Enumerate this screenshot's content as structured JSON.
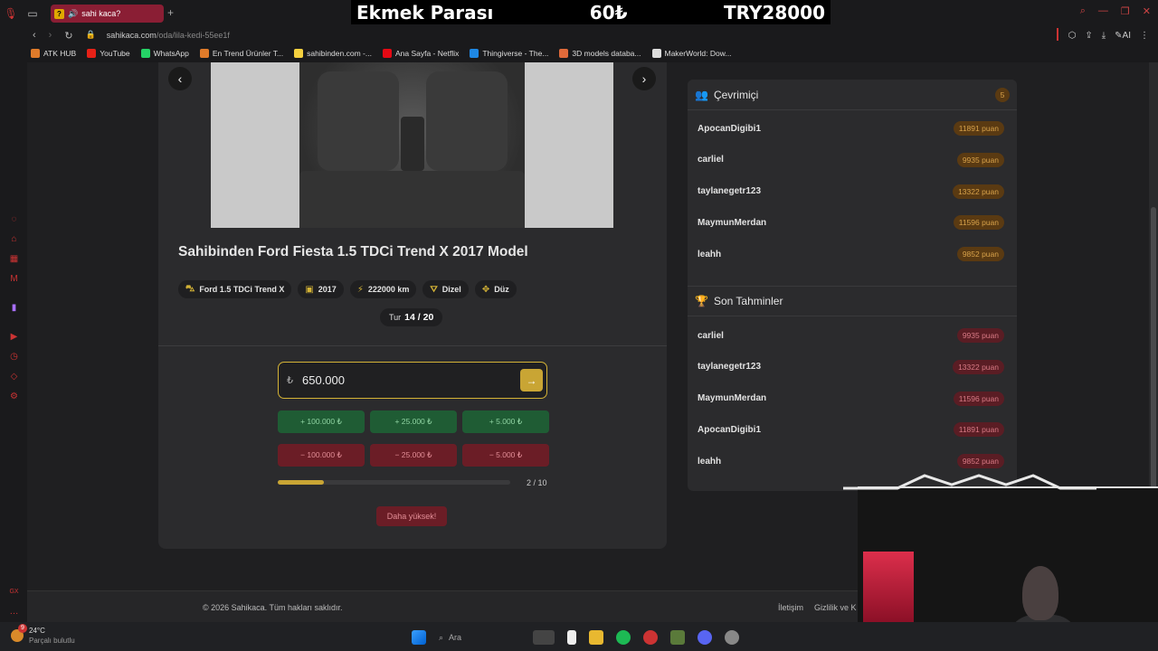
{
  "browser": {
    "tab_title": "sahi kaca?",
    "url_domain": "sahikaca.com",
    "url_path": "/oda/lila-kedi-55ee1f",
    "bookmarks": [
      "ATK HUB",
      "YouTube",
      "WhatsApp",
      "En Trend Ürünler T...",
      "sahibinden.com -...",
      "Ana Sayfa - Netflix",
      "Thingiverse - The...",
      "3D models databa...",
      "MakerWorld: Dow..."
    ],
    "bookmark_colors": [
      "#e07b2a",
      "#e62117",
      "#25d366",
      "#e07b2a",
      "#f4d03f",
      "#e50914",
      "#1e88e5",
      "#e06a3a",
      "#dddddd"
    ],
    "ai_label": "AI"
  },
  "stream_overlay": {
    "label": "Ekmek Parası",
    "amount": "60₺",
    "total": "TRY28000"
  },
  "listing": {
    "title": "Sahibinden Ford Fiesta 1.5 TDCi Trend X 2017 Model",
    "chips": [
      {
        "icon": "car-icon",
        "glyph": "⛍",
        "label": "Ford 1.5 TDCi Trend X"
      },
      {
        "icon": "calendar-icon",
        "glyph": "▣",
        "label": "2017"
      },
      {
        "icon": "gauge-icon",
        "glyph": "⚡",
        "label": "222000 km"
      },
      {
        "icon": "fuel-icon",
        "glyph": "⛛",
        "label": "Dizel"
      },
      {
        "icon": "gear-icon",
        "glyph": "✥",
        "label": "Düz"
      }
    ],
    "round_label": "Tur",
    "round_value": "14 / 20"
  },
  "guess": {
    "currency": "₺",
    "value": "650.000",
    "plus_buttons": [
      "+ 100.000 ₺",
      "+ 25.000 ₺",
      "+ 5.000 ₺"
    ],
    "minus_buttons": [
      "− 100.000 ₺",
      "− 25.000 ₺",
      "− 5.000 ₺"
    ],
    "progress_fraction": 0.2,
    "progress_label": "2 / 10",
    "hint_button": "Daha yüksek!"
  },
  "online": {
    "title": "Çevrimiçi",
    "count": "5",
    "users": [
      {
        "name": "ApocanDigibi1",
        "points": "11891 puan"
      },
      {
        "name": "carliel",
        "points": "9935 puan"
      },
      {
        "name": "taylanegetr123",
        "points": "13322 puan"
      },
      {
        "name": "MaymunMerdan",
        "points": "11596 puan"
      },
      {
        "name": "leahh",
        "points": "9852 puan"
      }
    ]
  },
  "recent": {
    "title": "Son Tahminler",
    "guesses": [
      {
        "name": "carliel",
        "points": "9935 puan"
      },
      {
        "name": "taylanegetr123",
        "points": "13322 puan"
      },
      {
        "name": "MaymunMerdan",
        "points": "11596 puan"
      },
      {
        "name": "ApocanDigibi1",
        "points": "11891 puan"
      },
      {
        "name": "leahh",
        "points": "9852 puan"
      }
    ]
  },
  "footer": {
    "copyright": "© 2026 Sahikaca. Tüm hakları saklıdır.",
    "links": [
      "İletişim",
      "Gizlilik ve K"
    ]
  },
  "taskbar": {
    "notif_count": "9",
    "temperature": "24°C",
    "weather": "Parçalı bulutlu",
    "search_placeholder": "Ara"
  },
  "colors": {
    "accent": "#d4b336",
    "plus": "#1f5c34",
    "minus": "#6b1d26"
  }
}
